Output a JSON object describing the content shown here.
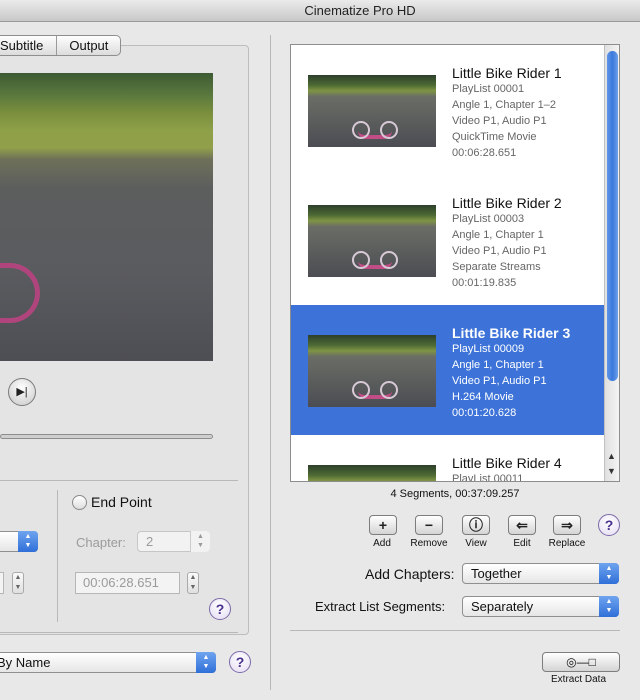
{
  "window": {
    "title": "Cinematize Pro HD"
  },
  "tabs": [
    {
      "label": "Subtitle"
    },
    {
      "label": "Output"
    }
  ],
  "range": {
    "end_point_label": "End Point",
    "chapter_label": "Chapter:",
    "chapter_value": "2",
    "end_time_value": "00:06:28.651"
  },
  "left_bottom": {
    "sort_popup": "By Name"
  },
  "playlist": {
    "items": [
      {
        "title": "Little Bike Rider 1",
        "lines": [
          "PlayList 00001",
          "Angle 1, Chapter 1–2",
          "Video P1, Audio P1",
          "QuickTime Movie",
          "00:06:28.651"
        ]
      },
      {
        "title": "Little Bike Rider 2",
        "lines": [
          "PlayList 00003",
          "Angle 1, Chapter 1",
          "Video P1, Audio P1",
          "Separate Streams",
          "00:01:19.835"
        ]
      },
      {
        "title": "Little Bike Rider 3",
        "lines": [
          "PlayList 00009",
          "Angle 1, Chapter 1",
          "Video P1, Audio P1",
          "H.264 Movie",
          "00:01:20.628"
        ],
        "selected": true
      },
      {
        "title": "Little Bike Rider 4",
        "lines": [
          "PlayList 00011"
        ]
      }
    ],
    "summary": "4 Segments, 00:37:09.257"
  },
  "toolbar": {
    "add_label": "Add",
    "remove_label": "Remove",
    "view_label": "View",
    "edit_label": "Edit",
    "replace_label": "Replace"
  },
  "options": {
    "add_chapters_label": "Add Chapters:",
    "add_chapters_value": "Together",
    "extract_segments_label": "Extract List Segments:",
    "extract_segments_value": "Separately"
  },
  "extract_button_label": "Extract Data",
  "colors": {
    "selection": "#3d73d8",
    "accent": "#2f6fd8"
  },
  "icons": {
    "play": "play-icon",
    "add": "plus-icon",
    "remove": "minus-icon",
    "view": "info-icon",
    "edit": "edit-icon",
    "replace": "replace-icon",
    "extract": "extract-icon",
    "help": "help-icon"
  }
}
